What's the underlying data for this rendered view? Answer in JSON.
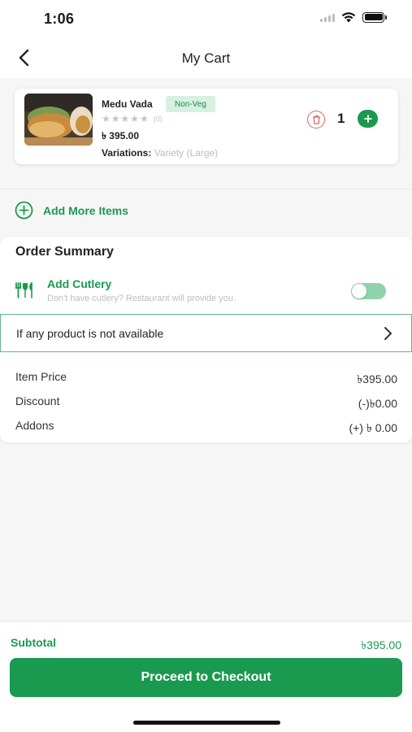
{
  "status_bar": {
    "time": "1:06"
  },
  "header": {
    "title": "My Cart"
  },
  "cart_item": {
    "name": "Medu Vada",
    "badge": "Non-Veg",
    "rating_count": "(0)",
    "price": "৳ 395.00",
    "variations_label": "Variations:",
    "variations_value": "Variety (Large)",
    "quantity": "1"
  },
  "add_more": {
    "label": "Add More Items"
  },
  "summary": {
    "title": "Order Summary",
    "cutlery_label": "Add Cutlery",
    "cutlery_sub": "Don't have cutlery? Restaurant will provide you.",
    "not_available_label": "If any product is not available",
    "rows": [
      {
        "label": "Item Price",
        "value": "৳395.00"
      },
      {
        "label": "Discount",
        "value": "(-)৳0.00"
      },
      {
        "label": "Addons",
        "value": "(+) ৳ 0.00"
      }
    ]
  },
  "bottom": {
    "subtotal_label": "Subtotal",
    "subtotal_value": "৳395.00",
    "checkout_label": "Proceed to Checkout"
  },
  "colors": {
    "primary": "#1a9a4f",
    "badge_bg": "#d7f0e1",
    "delete": "#e06060"
  },
  "icons": [
    "back-chevron-icon",
    "wifi-icon",
    "battery-icon",
    "trash-icon",
    "plus-icon",
    "add-circle-icon",
    "cutlery-icon",
    "chevron-right-icon",
    "star-icon"
  ]
}
